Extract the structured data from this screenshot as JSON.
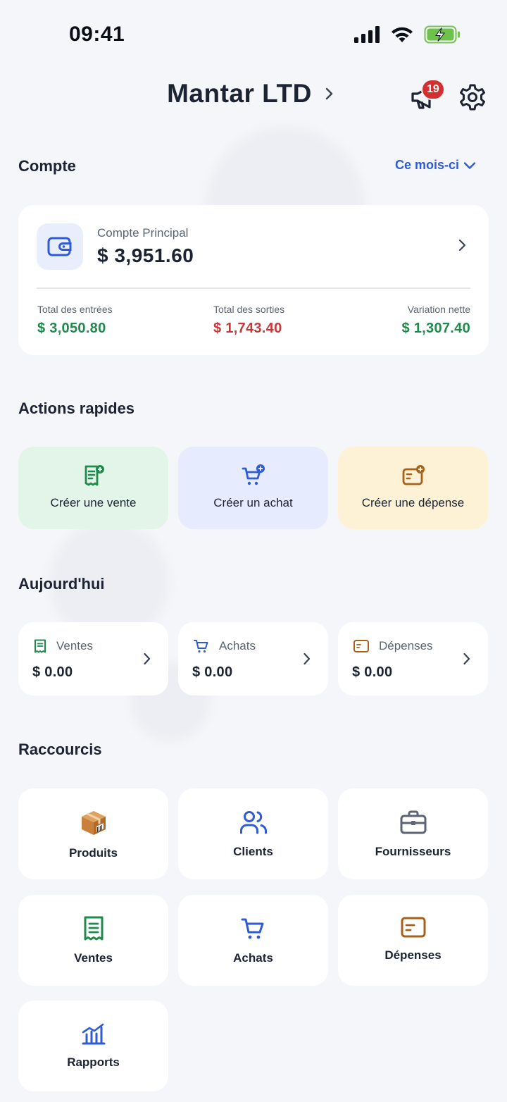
{
  "status_bar": {
    "time": "09:41"
  },
  "header": {
    "company": "Mantar LTD",
    "notification_count": "19"
  },
  "account_section": {
    "title": "Compte",
    "period": "Ce mois-ci",
    "account_name": "Compte Principal",
    "balance": "$ 3,951.60",
    "stats": [
      {
        "label": "Total des entrées",
        "value": "$ 3,050.80"
      },
      {
        "label": "Total des sorties",
        "value": "$ 1,743.40"
      },
      {
        "label": "Variation nette",
        "value": "$ 1,307.40"
      }
    ]
  },
  "quick_actions": {
    "title": "Actions rapides",
    "items": [
      {
        "label": "Créer une vente"
      },
      {
        "label": "Créer un achat"
      },
      {
        "label": "Créer une dépense"
      }
    ]
  },
  "today": {
    "title": "Aujourd'hui",
    "items": [
      {
        "label": "Ventes",
        "value": "$ 0.00"
      },
      {
        "label": "Achats",
        "value": "$ 0.00"
      },
      {
        "label": "Dépenses",
        "value": "$ 0.00"
      }
    ]
  },
  "shortcuts": {
    "title": "Raccourcis",
    "items": [
      {
        "label": "Produits"
      },
      {
        "label": "Clients"
      },
      {
        "label": "Fournisseurs"
      },
      {
        "label": "Ventes"
      },
      {
        "label": "Achats"
      },
      {
        "label": "Dépenses"
      },
      {
        "label": "Rapports"
      }
    ]
  },
  "colors": {
    "background": "#f4f6f9",
    "accent_blue": "#2f5bd3",
    "positive_green": "#1f8a4c",
    "negative_red": "#c6383a",
    "badge_red": "#d32f2f",
    "sale_tile": "#e3f4e9",
    "purchase_tile": "#e6ebfd",
    "expense_tile": "#fdf2d6",
    "expense_brown": "#a6621a"
  }
}
